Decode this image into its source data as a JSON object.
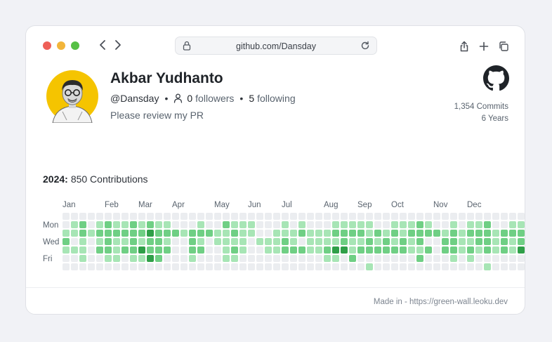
{
  "browser": {
    "url": "github.com/Dansday",
    "back_symbol": "‹",
    "forward_symbol": "›",
    "traffic_colors": [
      "#ee5f57",
      "#f2b53a",
      "#56c045"
    ]
  },
  "profile": {
    "name": "Akbar Yudhanto",
    "handle": "@Dansday",
    "followers_count": "0",
    "followers_label": "followers",
    "following_count": "5",
    "following_label": "following",
    "bio": "Please review my PR",
    "commits": "1,354 Commits",
    "years": "6 Years"
  },
  "contributions": {
    "year": "2024:",
    "count_label": "850 Contributions",
    "months": [
      "Jan",
      "Feb",
      "Mar",
      "Apr",
      "May",
      "Jun",
      "Jul",
      "Aug",
      "Sep",
      "Oct",
      "Nov",
      "Dec"
    ],
    "day_labels": [
      "Mon",
      "Wed",
      "Fri"
    ],
    "palette": [
      "#ebedf0",
      "#a7e5b5",
      "#6fcf84",
      "#2f9f48",
      "#1e6b34"
    ],
    "weeks": [
      "0012100",
      "0110100",
      "0221110",
      "0010000",
      "0121200",
      "0222210",
      "0121110",
      "0121200",
      "0222210",
      "0121310",
      "0232230",
      "0122220",
      "0121200",
      "0020000",
      "0010000",
      "0022210",
      "0121200",
      "0020000",
      "0011000",
      "0211110",
      "0121210",
      "0111100",
      "0110000",
      "0001000",
      "0001100",
      "0011100",
      "0112200",
      "0011200",
      "0120200",
      "0011100",
      "0011100",
      "0011210",
      "0121310",
      "0122300",
      "0121120",
      "0121200",
      "0112201",
      "0021200",
      "0012200",
      "0121200",
      "0112200",
      "0121100",
      "0222120",
      "0120200",
      "0020000",
      "0012200",
      "0122210",
      "0011100",
      "0121210",
      "0122100",
      "0222201",
      "0011100",
      "0022200",
      "0121100",
      "0122300",
      "0232210",
      "0223310",
      "0120101",
      "0121200",
      "0142210",
      "0111110",
      "0221200",
      "0020101",
      "0121100",
      "0021100",
      "0021100"
    ]
  },
  "footer": {
    "text": "Made in - https://green-wall.leoku.dev"
  }
}
